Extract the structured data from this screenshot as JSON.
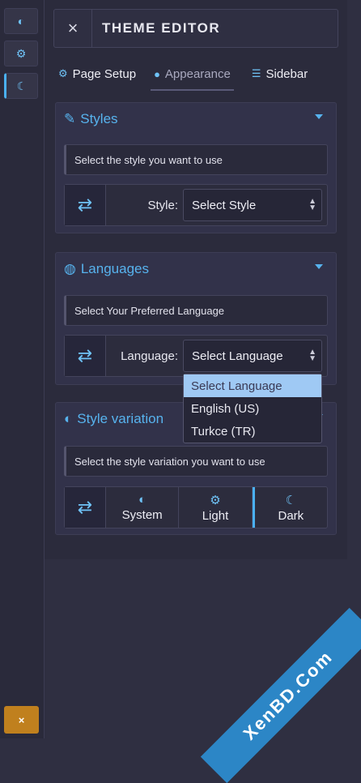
{
  "rail": {
    "items": [
      {
        "icon": "half-circle-icon"
      },
      {
        "icon": "gear-icon"
      },
      {
        "icon": "moon-icon"
      }
    ],
    "close_label": "×"
  },
  "header": {
    "close_label": "×",
    "title": "THEME EDITOR"
  },
  "tabs": [
    {
      "label": "Page Setup",
      "icon": "gears-icon"
    },
    {
      "label": "Appearance",
      "icon": "palette-icon"
    },
    {
      "label": "Sidebar",
      "icon": "list-icon"
    }
  ],
  "styles": {
    "title": "Styles",
    "note": "Select the style you want to use",
    "field_label": "Style:",
    "value": "Select Style"
  },
  "languages": {
    "title": "Languages",
    "note": "Select Your Preferred Language",
    "field_label": "Language:",
    "value": "Select Language",
    "options": [
      "Select Language",
      "English (US)",
      "Turkce (TR)"
    ]
  },
  "variation": {
    "title": "Style variation",
    "note": "Select the style variation you want to use",
    "buttons": [
      "System",
      "Light",
      "Dark"
    ]
  },
  "watermark": "XenBD.Com"
}
